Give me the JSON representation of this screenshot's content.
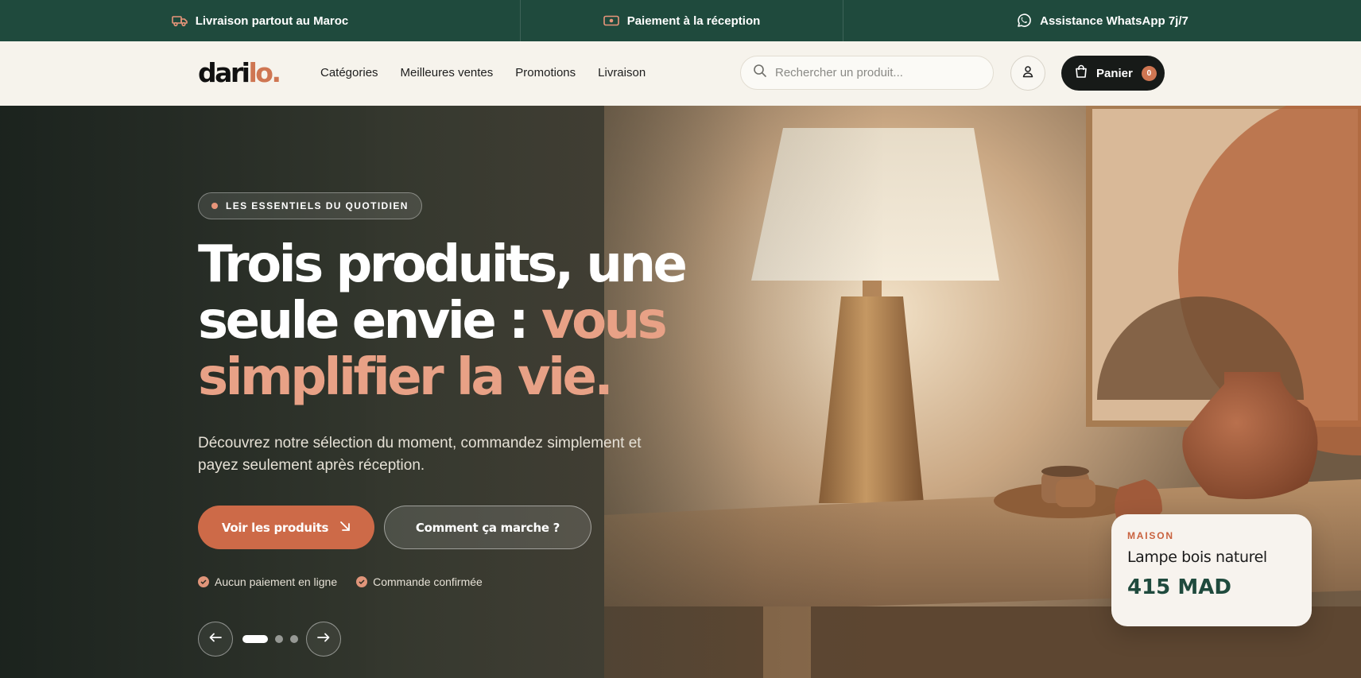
{
  "topbar": {
    "items": [
      {
        "icon": "truck-icon",
        "label": "Livraison partout au Maroc"
      },
      {
        "icon": "cash-icon",
        "label": "Paiement à la réception"
      },
      {
        "icon": "whatsapp-icon",
        "label": "Assistance WhatsApp 7j/7"
      }
    ]
  },
  "header": {
    "logo_main": "dari",
    "logo_accent": "lo.",
    "nav": [
      "Catégories",
      "Meilleures ventes",
      "Promotions",
      "Livraison"
    ],
    "search_placeholder": "Rechercher un produit...",
    "account_icon": "user-icon",
    "cart_label": "Panier",
    "cart_count": "0"
  },
  "hero": {
    "badge": "LES ESSENTIELS DU QUOTIDIEN",
    "headline_line1": "Trois produits, une",
    "headline_line2": "seule envie : ",
    "headline_accent_1": "vous",
    "headline_accent_2": "simplifier la vie.",
    "lead": "Découvrez notre sélection du moment, commandez simplement et payez seulement après réception.",
    "cta_primary": "Voir les produits",
    "cta_secondary": "Comment ça marche ?",
    "assurances": [
      "Aucun paiement en ligne",
      "Commande confirmée"
    ],
    "slides_total": 3,
    "slide_active": 1
  },
  "product_card": {
    "category": "MAISON",
    "name": "Lampe bois naturel",
    "price": "415 MAD"
  },
  "colors": {
    "topbar_bg": "#1f4a3d",
    "header_bg": "#f6f3ec",
    "accent": "#cd6a48",
    "accent_light": "#e8a186",
    "cart_bg": "#171a18"
  }
}
